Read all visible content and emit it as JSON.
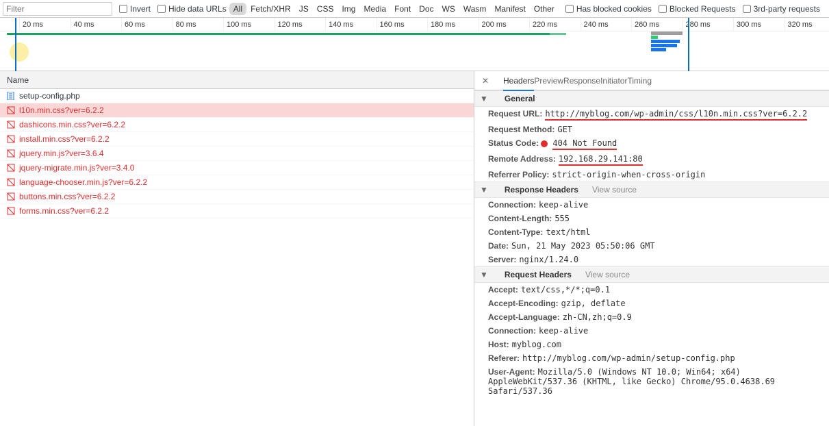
{
  "toolbar": {
    "filter_placeholder": "Filter",
    "invert": "Invert",
    "hide_data_urls": "Hide data URLs",
    "types": [
      "All",
      "Fetch/XHR",
      "JS",
      "CSS",
      "Img",
      "Media",
      "Font",
      "Doc",
      "WS",
      "Wasm",
      "Manifest",
      "Other"
    ],
    "active_type": "All",
    "has_blocked_cookies": "Has blocked cookies",
    "blocked_requests": "Blocked Requests",
    "third_party": "3rd-party requests"
  },
  "timeline": {
    "ticks": [
      "20 ms",
      "40 ms",
      "60 ms",
      "80 ms",
      "100 ms",
      "120 ms",
      "140 ms",
      "160 ms",
      "180 ms",
      "200 ms",
      "220 ms",
      "240 ms",
      "260 ms",
      "280 ms",
      "300 ms",
      "320 ms"
    ]
  },
  "requests": {
    "header": "Name",
    "rows": [
      {
        "name": "setup-config.php",
        "status": "ok",
        "icon": "doc"
      },
      {
        "name": "l10n.min.css?ver=6.2.2",
        "status": "err",
        "icon": "css",
        "selected": true
      },
      {
        "name": "dashicons.min.css?ver=6.2.2",
        "status": "err",
        "icon": "css"
      },
      {
        "name": "install.min.css?ver=6.2.2",
        "status": "err",
        "icon": "css"
      },
      {
        "name": "jquery.min.js?ver=3.6.4",
        "status": "err",
        "icon": "js"
      },
      {
        "name": "jquery-migrate.min.js?ver=3.4.0",
        "status": "err",
        "icon": "js"
      },
      {
        "name": "language-chooser.min.js?ver=6.2.2",
        "status": "err",
        "icon": "js"
      },
      {
        "name": "buttons.min.css?ver=6.2.2",
        "status": "err",
        "icon": "css"
      },
      {
        "name": "forms.min.css?ver=6.2.2",
        "status": "err",
        "icon": "css"
      }
    ]
  },
  "details": {
    "tabs": [
      "Headers",
      "Preview",
      "Response",
      "Initiator",
      "Timing"
    ],
    "active_tab": "Headers",
    "general": {
      "title": "General",
      "request_url_k": "Request URL:",
      "request_url_v": "http://myblog.com/wp-admin/css/l10n.min.css?ver=6.2.2",
      "request_method_k": "Request Method:",
      "request_method_v": "GET",
      "status_code_k": "Status Code:",
      "status_code_v": "404 Not Found",
      "remote_addr_k": "Remote Address:",
      "remote_addr_v": "192.168.29.141:80",
      "referrer_policy_k": "Referrer Policy:",
      "referrer_policy_v": "strict-origin-when-cross-origin"
    },
    "response_headers": {
      "title": "Response Headers",
      "view_source": "View source",
      "items": [
        {
          "k": "Connection:",
          "v": "keep-alive"
        },
        {
          "k": "Content-Length:",
          "v": "555"
        },
        {
          "k": "Content-Type:",
          "v": "text/html"
        },
        {
          "k": "Date:",
          "v": "Sun, 21 May 2023 05:50:06 GMT"
        },
        {
          "k": "Server:",
          "v": "nginx/1.24.0"
        }
      ]
    },
    "request_headers": {
      "title": "Request Headers",
      "view_source": "View source",
      "items": [
        {
          "k": "Accept:",
          "v": "text/css,*/*;q=0.1"
        },
        {
          "k": "Accept-Encoding:",
          "v": "gzip, deflate"
        },
        {
          "k": "Accept-Language:",
          "v": "zh-CN,zh;q=0.9"
        },
        {
          "k": "Connection:",
          "v": "keep-alive"
        },
        {
          "k": "Host:",
          "v": "myblog.com"
        },
        {
          "k": "Referer:",
          "v": "http://myblog.com/wp-admin/setup-config.php"
        },
        {
          "k": "User-Agent:",
          "v": "Mozilla/5.0 (Windows NT 10.0; Win64; x64) AppleWebKit/537.36 (KHTML, like Gecko) Chrome/95.0.4638.69 Safari/537.36"
        }
      ]
    }
  }
}
